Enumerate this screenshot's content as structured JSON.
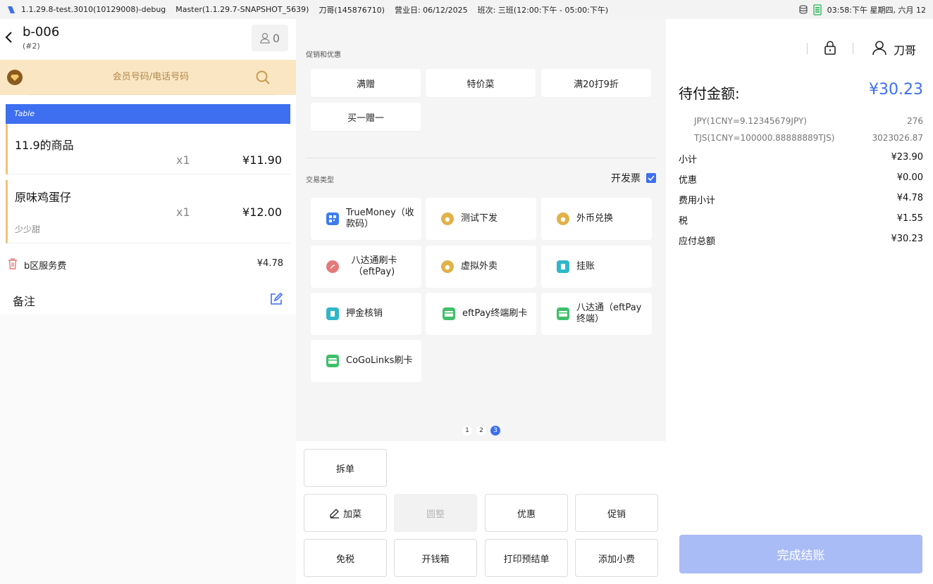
{
  "status_bar": {
    "version": "1.1.29.8-test.3010(10129008)-debug",
    "master": "Master(1.1.29.7-SNAPSHOT_5639)",
    "user": "刀哥(145876710)",
    "business_day": "营业日: 06/12/2025",
    "shift": "班次: 三班(12:00:下午 - 05:00:下午)",
    "clock": "03:58:下午 星期四, 六月 12"
  },
  "order": {
    "title": "b-006",
    "subtitle": "(#2)",
    "guest_count": "0"
  },
  "member": {
    "placeholder": "会员号码/电话号码"
  },
  "cart": {
    "section_label": "Table",
    "items": [
      {
        "name": "11.9的商品",
        "qty": "x1",
        "price": "¥11.90",
        "note": ""
      },
      {
        "name": "原味鸡蛋仔",
        "qty": "x1",
        "price": "¥12.00",
        "note": "少少甜"
      }
    ],
    "service_fee": {
      "label": "b区服务费",
      "amount": "¥4.78"
    },
    "remark_label": "备注"
  },
  "promotions": {
    "title": "促销和优惠",
    "buttons": [
      "满赠",
      "特价菜",
      "满20打9折",
      "买一赠一"
    ]
  },
  "transactions": {
    "title": "交易类型",
    "invoice_label": "开发票",
    "invoice_checked": true,
    "buttons": [
      {
        "label": "TrueMoney（收款码）",
        "icon": "qr-code-icon",
        "color": "#3d7cf0"
      },
      {
        "label": "测试下发",
        "icon": "money-bag-icon",
        "color": "#e0b24a"
      },
      {
        "label": "外币兑换",
        "icon": "money-bag-icon",
        "color": "#e0b24a"
      },
      {
        "label": "八达通刷卡（eftPay)",
        "icon": "octopus-card-icon",
        "color": "#e47a7a"
      },
      {
        "label": "虚拟外卖",
        "icon": "money-bag-icon",
        "color": "#e0b24a"
      },
      {
        "label": "挂账",
        "icon": "ledger-icon",
        "color": "#2fb7c9"
      },
      {
        "label": "押金核销",
        "icon": "deposit-icon",
        "color": "#2fb7c9"
      },
      {
        "label": "eftPay终端刷卡",
        "icon": "card-icon",
        "color": "#3fbf6a"
      },
      {
        "label": "八达通（eftPay终端）",
        "icon": "card-icon",
        "color": "#3fbf6a"
      },
      {
        "label": "CoGoLinks刷卡",
        "icon": "card-icon",
        "color": "#3fbf6a"
      }
    ],
    "pages": [
      "1",
      "2",
      "3"
    ],
    "active_page": "3"
  },
  "actions": {
    "split": "拆单",
    "add_item": "加菜",
    "round": "圆整",
    "discount": "优惠",
    "promotion": "促销",
    "tax_free": "免税",
    "open_drawer": "开钱箱",
    "print_prebill": "打印预结单",
    "add_tip": "添加小费"
  },
  "summary": {
    "user_name": "刀哥",
    "due_label": "待付金额:",
    "due_amount": "¥30.23",
    "fx": [
      {
        "label": "JPY(1CNY=9.12345679JPY)",
        "value": "276"
      },
      {
        "label": "TJS(1CNY=100000.88888889TJS)",
        "value": "3023026.87"
      }
    ],
    "rows": [
      {
        "label": "小计",
        "value": "¥23.90"
      },
      {
        "label": "优惠",
        "value": "¥0.00"
      },
      {
        "label": "费用小计",
        "value": "¥4.78"
      },
      {
        "label": "税",
        "value": "¥1.55"
      },
      {
        "label": "应付总额",
        "value": "¥30.23"
      }
    ],
    "checkout_label": "完成结账"
  },
  "colors": {
    "accent": "#3d6ff0",
    "member_bar": "#fbe6c4",
    "item_border": "#f0c27a",
    "checkout_disabled": "#a9bcf6"
  }
}
